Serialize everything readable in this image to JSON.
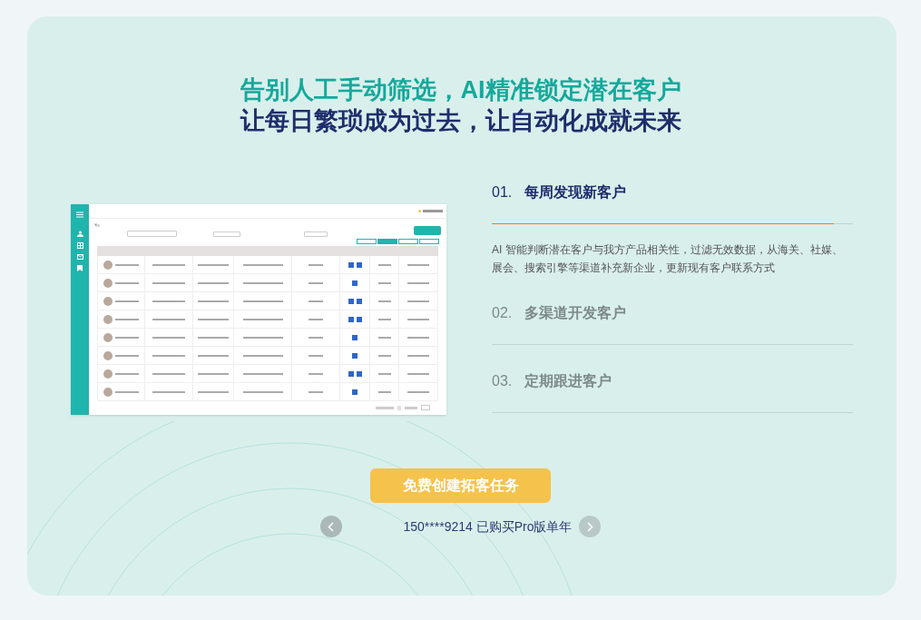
{
  "headline": {
    "line_1": "告别人工手动筛选，AI精准锁定潜在客户",
    "line_2": "让每日繁琐成为过去，让自动化成就未来"
  },
  "features": [
    {
      "number": "01.",
      "title": "每周发现新客户",
      "expanded": true,
      "description": "AI 智能判断潜在客户与我方产品相关性，过滤无效数据，从海关、社媒、展会、搜索引擎等渠道补充新企业，更新现有客户联系方式"
    },
    {
      "number": "02.",
      "title": "多渠道开发客户",
      "expanded": false
    },
    {
      "number": "03.",
      "title": "定期跟进客户",
      "expanded": false
    }
  ],
  "cta_button": "免费创建拓客任务",
  "ticker": "150****9214 已购买Pro版单年"
}
